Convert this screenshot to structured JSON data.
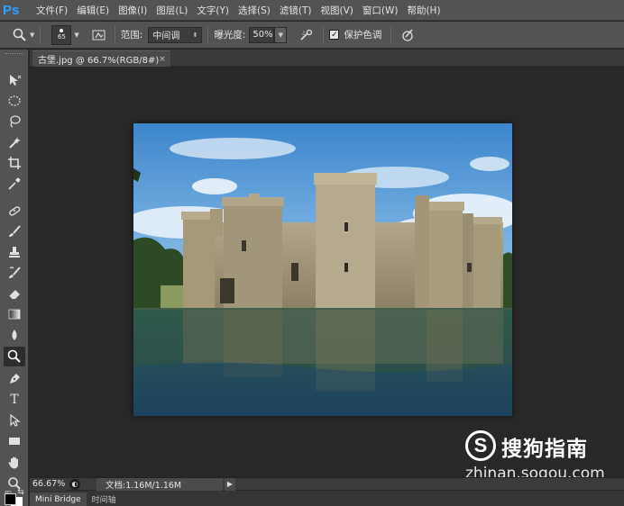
{
  "app": {
    "logo_text": "Ps"
  },
  "menu": [
    "文件(F)",
    "编辑(E)",
    "图像(I)",
    "图层(L)",
    "文字(Y)",
    "选择(S)",
    "滤镜(T)",
    "视图(V)",
    "窗口(W)",
    "帮助(H)"
  ],
  "options": {
    "brush_size": "65",
    "range_label": "范围:",
    "range_value": "中间调",
    "exposure_label": "曝光度:",
    "exposure_value": "50%",
    "protect_tones_label": "保护色调",
    "protect_tones_checked": true
  },
  "document": {
    "tab_title": "古堡.jpg @ 66.7%(RGB/8#)",
    "close_glyph": "×"
  },
  "status": {
    "zoom": "66.67%",
    "doc_info": "文档:1.16M/1.16M"
  },
  "bottom_tabs": [
    "Mini Bridge",
    "时间轴"
  ],
  "watermark": {
    "logo": "S",
    "title": "搜狗指南",
    "url": "zhinan.sogou.com"
  },
  "tools": [
    "move-icon",
    "marquee-icon",
    "lasso-icon",
    "quick-select-icon",
    "crop-icon",
    "eyedropper-icon",
    "healing-brush-icon",
    "brush-icon",
    "clone-stamp-icon",
    "history-brush-icon",
    "eraser-icon",
    "gradient-icon",
    "blur-icon",
    "dodge-icon",
    "pen-icon",
    "type-icon",
    "path-select-icon",
    "rectangle-icon",
    "hand-icon",
    "zoom-icon"
  ],
  "colors": {
    "accent": "#2fa3ff",
    "panel": "#535353",
    "canvas_bg": "#282828"
  }
}
